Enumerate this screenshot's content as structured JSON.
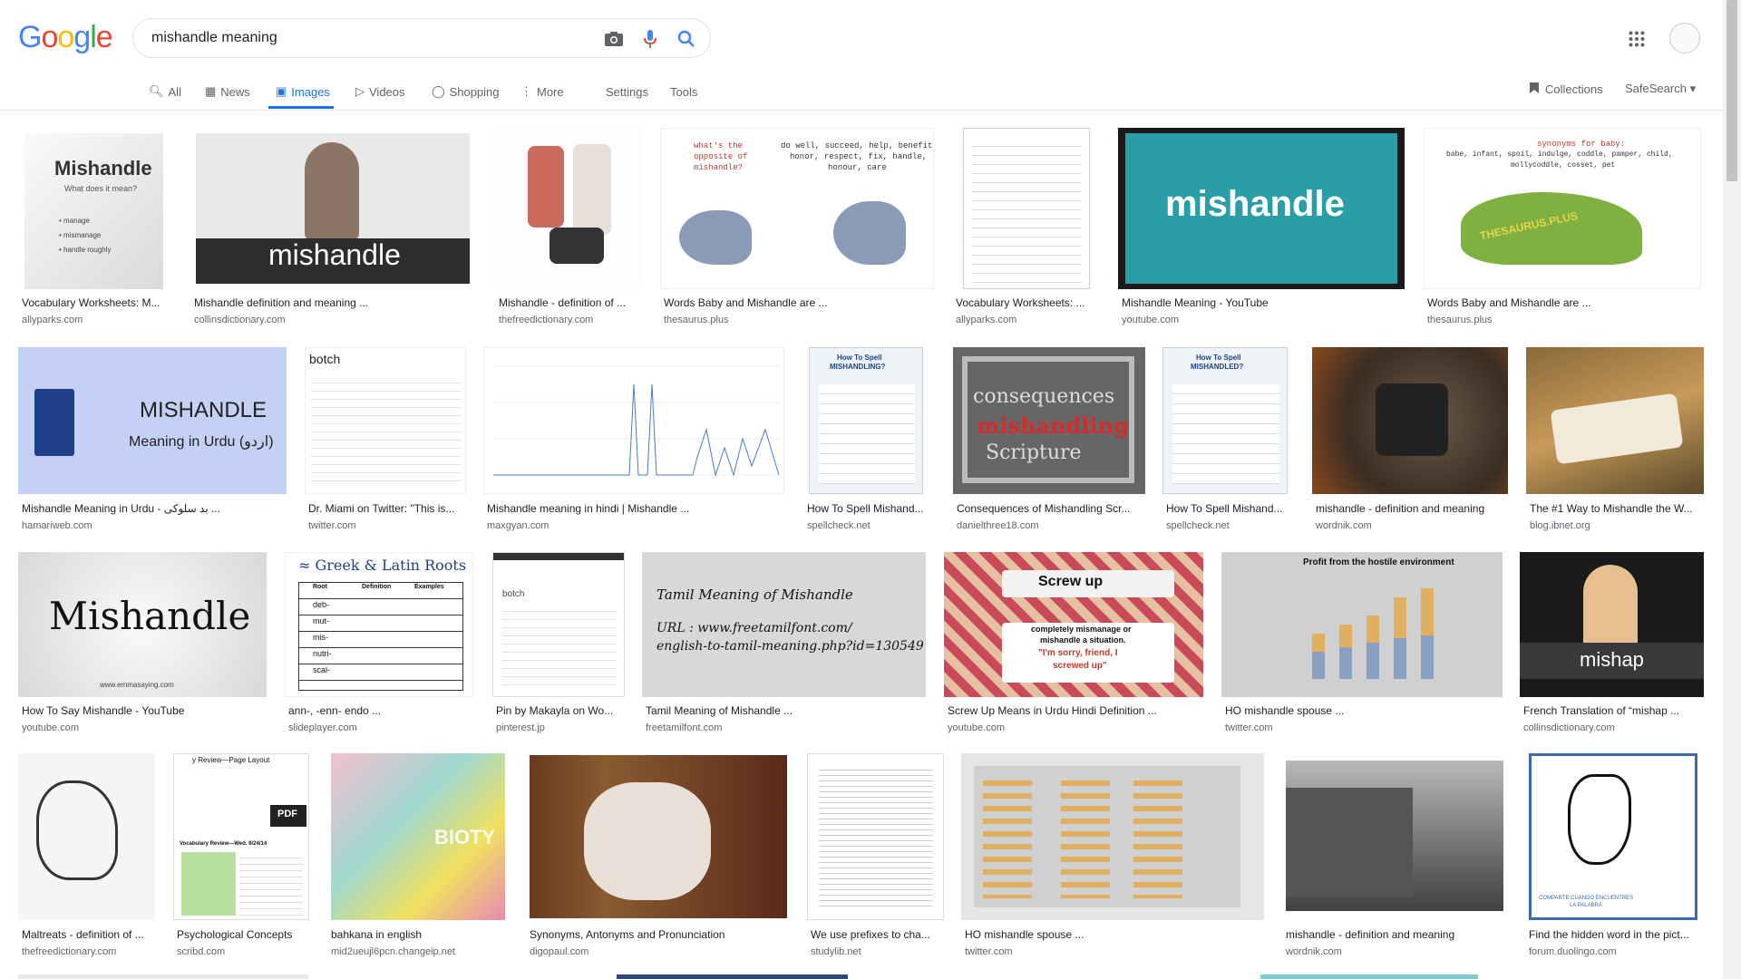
{
  "header": {
    "logo": "Google",
    "search_query": "mishandle meaning",
    "tabs": [
      {
        "label": "All"
      },
      {
        "label": "News"
      },
      {
        "label": "Images"
      },
      {
        "label": "Videos"
      },
      {
        "label": "Shopping"
      },
      {
        "label": "More"
      },
      {
        "label": "Settings"
      },
      {
        "label": "Tools"
      }
    ],
    "collections": "Collections",
    "safesearch": "SafeSearch"
  },
  "results": [
    {
      "title": "Vocabulary Worksheets: M...",
      "source": "allyparks.com",
      "thumb_text": [
        "Mishandle",
        "What does it mean?",
        "• manage",
        "• mismanage",
        "• handle roughly"
      ]
    },
    {
      "title": "Mishandle definition and meaning ...",
      "source": "collinsdictionary.com",
      "thumb_text": [
        "mishandle"
      ]
    },
    {
      "title": "Mishandle - definition of ...",
      "source": "thefreedictionary.com",
      "thumb_text": []
    },
    {
      "title": "Words Baby and Mishandle are ...",
      "source": "thesaurus.plus",
      "thumb_text": [
        "what's the",
        "opposite of",
        "mishandle?",
        "do well, succeed, help, benefit,",
        "honor, respect, fix, handle,",
        "honour, care"
      ]
    },
    {
      "title": "Vocabulary Worksheets: ...",
      "source": "allyparks.com",
      "thumb_text": []
    },
    {
      "title": "Mishandle Meaning - YouTube",
      "source": "youtube.com",
      "thumb_text": [
        "mishandle"
      ]
    },
    {
      "title": "Words Baby and Mishandle are ...",
      "source": "thesaurus.plus",
      "thumb_text": [
        "synonyms for baby:",
        "babe, infant, spoil, indulge, coddle, pamper, child,",
        "mollycoddle, cosset, pet",
        "THESAURUS.PLUS"
      ]
    },
    {
      "title": "Mishandle Meaning in Urdu - بد سلوکی ...",
      "source": "hamariweb.com",
      "thumb_text": [
        "MISHANDLE",
        "Meaning in Urdu (اردو)"
      ]
    },
    {
      "title": "Dr. Miami on Twitter: \"This is...",
      "source": "twitter.com",
      "thumb_text": [
        "botch"
      ]
    },
    {
      "title": "Mishandle meaning in hindi | Mishandle ...",
      "source": "maxgyan.com",
      "thumb_text": []
    },
    {
      "title": "How To Spell Mishand...",
      "source": "spellcheck.net",
      "thumb_text": [
        "How To Spell",
        "MISHANDLING?"
      ]
    },
    {
      "title": "Consequences of Mishandling Scr...",
      "source": "danielthree18.com",
      "thumb_text": [
        "consequences",
        "mishandling",
        "Scripture"
      ]
    },
    {
      "title": "How To Spell Mishand...",
      "source": "spellcheck.net",
      "thumb_text": [
        "How To Spell",
        "MISHANDLED?"
      ]
    },
    {
      "title": "mishandle - definition and meaning",
      "source": "wordnik.com",
      "thumb_text": []
    },
    {
      "title": "The #1 Way to Mishandle the W...",
      "source": "blog.ibnet.org",
      "thumb_text": []
    },
    {
      "title": "How To Say Mishandle - YouTube",
      "source": "youtube.com",
      "thumb_text": [
        "Mishandle",
        "www.emmasaying.com"
      ]
    },
    {
      "title": "ann-, -enn- endo ...",
      "source": "slideplayer.com",
      "thumb_text": [
        "≈ Greek & Latin Roots ≈",
        "Root",
        "Definition",
        "Examples",
        "deb-",
        "mut-",
        "mis-",
        "nutri-",
        "scal-"
      ]
    },
    {
      "title": "Pin by Makayla on Wo...",
      "source": "pinterest.jp",
      "thumb_text": [
        "botch"
      ]
    },
    {
      "title": "Tamil Meaning of Mishandle ...",
      "source": "freetamilfont.com",
      "thumb_text": [
        "Tamil Meaning of Mishandle",
        "URL : www.freetamilfont.com/",
        "english-to-tamil-meaning.php?id=130549"
      ]
    },
    {
      "title": "Screw Up Means in Urdu Hindi Definition ...",
      "source": "youtube.com",
      "thumb_text": [
        "Screw up",
        "completely mismanage or",
        "mishandle a situation.",
        "\"I'm sorry, friend, I",
        "screwed up\""
      ]
    },
    {
      "title": "HO mishandle spouse ...",
      "source": "twitter.com",
      "thumb_text": [
        "Profit from the hostile environment"
      ]
    },
    {
      "title": "French Translation of “mishap ...",
      "source": "collinsdictionary.com",
      "thumb_text": [
        "mishap"
      ]
    },
    {
      "title": "Maltreats - definition of ...",
      "source": "thefreedictionary.com",
      "thumb_text": []
    },
    {
      "title": "Psychological Concepts",
      "source": "scribd.com",
      "thumb_text": [
        "y Review—Page Layout",
        "PDF",
        "Vocabulary Review—Wed. 9/24/14"
      ]
    },
    {
      "title": "bahkana in english",
      "source": "mid2ueujl6pcn.changeip.net",
      "thumb_text": [
        "BIOTY"
      ]
    },
    {
      "title": "Synonyms, Antonyms and Pronunciation",
      "source": "digopaul.com",
      "thumb_text": []
    },
    {
      "title": "We use prefixes to cha...",
      "source": "studylib.net",
      "thumb_text": []
    },
    {
      "title": "HO mishandle spouse ...",
      "source": "twitter.com",
      "thumb_text": []
    },
    {
      "title": "mishandle - definition and meaning",
      "source": "wordnik.com",
      "thumb_text": []
    },
    {
      "title": "Find the hidden word in the pict...",
      "source": "forum.duolingo.com",
      "thumb_text": [
        "COMPARTE CUANDO ENCUENTRES",
        "LA PALABRA"
      ]
    }
  ]
}
